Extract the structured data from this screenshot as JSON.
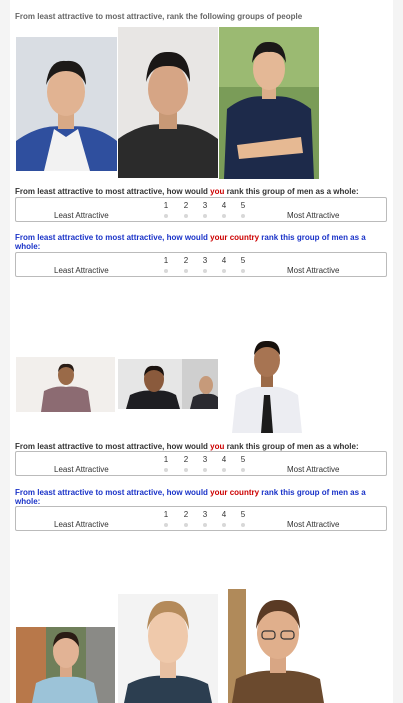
{
  "intro": "From least attractive to most attractive, rank the following groups of people",
  "question_you": {
    "pre": "From least attractive to most attractive, how would ",
    "em": "you",
    "post": " rank this group of men as a whole:"
  },
  "question_country": {
    "pre": "From least attractive to most attractive, how would ",
    "em": "your country",
    "post": " rank this group of men as a whole:"
  },
  "scale": {
    "least": "Least Attractive",
    "most": "Most Attractive",
    "options": [
      "1",
      "2",
      "3",
      "4",
      "5"
    ]
  },
  "colors": {
    "question_blue": "#1a33c8",
    "emphasis_red": "#cc0000",
    "dot_gray": "#d8d8d8"
  }
}
